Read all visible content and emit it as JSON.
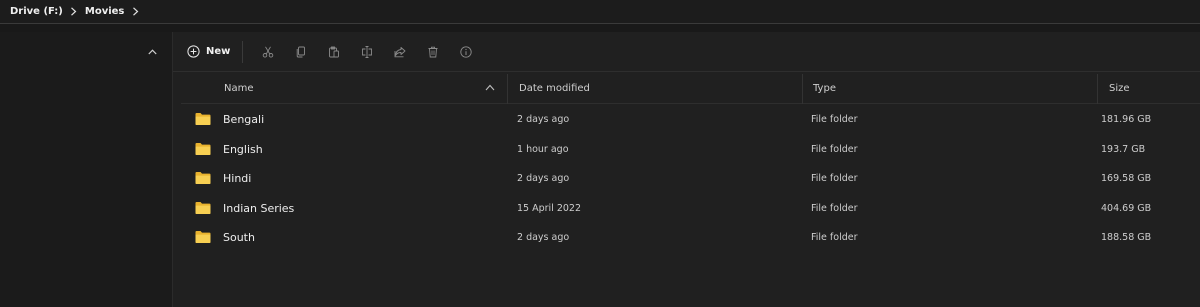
{
  "breadcrumb": {
    "items": [
      "Drive (F:)",
      "Movies"
    ]
  },
  "toolbar": {
    "new_label": "New",
    "actions": [
      "cut-icon",
      "copy-icon",
      "paste-icon",
      "rename-icon",
      "share-icon",
      "delete-icon",
      "info-icon"
    ]
  },
  "columns": {
    "name": "Name",
    "date_modified": "Date modified",
    "type": "Type",
    "size": "Size",
    "sort_column": "Name",
    "sort_direction": "ascending"
  },
  "files": [
    {
      "name": "Bengali",
      "date_modified": "2 days ago",
      "type": "File folder",
      "size": "181.96 GB"
    },
    {
      "name": "English",
      "date_modified": "1 hour ago",
      "type": "File folder",
      "size": "193.7 GB"
    },
    {
      "name": "Hindi",
      "date_modified": "2 days ago",
      "type": "File folder",
      "size": "169.58 GB"
    },
    {
      "name": "Indian Series",
      "date_modified": "15 April 2022",
      "type": "File folder",
      "size": "404.69 GB"
    },
    {
      "name": "South",
      "date_modified": "2 days ago",
      "type": "File folder",
      "size": "188.58 GB"
    }
  ],
  "colors": {
    "background": "#191919",
    "content_background": "#202020",
    "text": "#e6e6e6",
    "folder": "#f2c94c"
  }
}
